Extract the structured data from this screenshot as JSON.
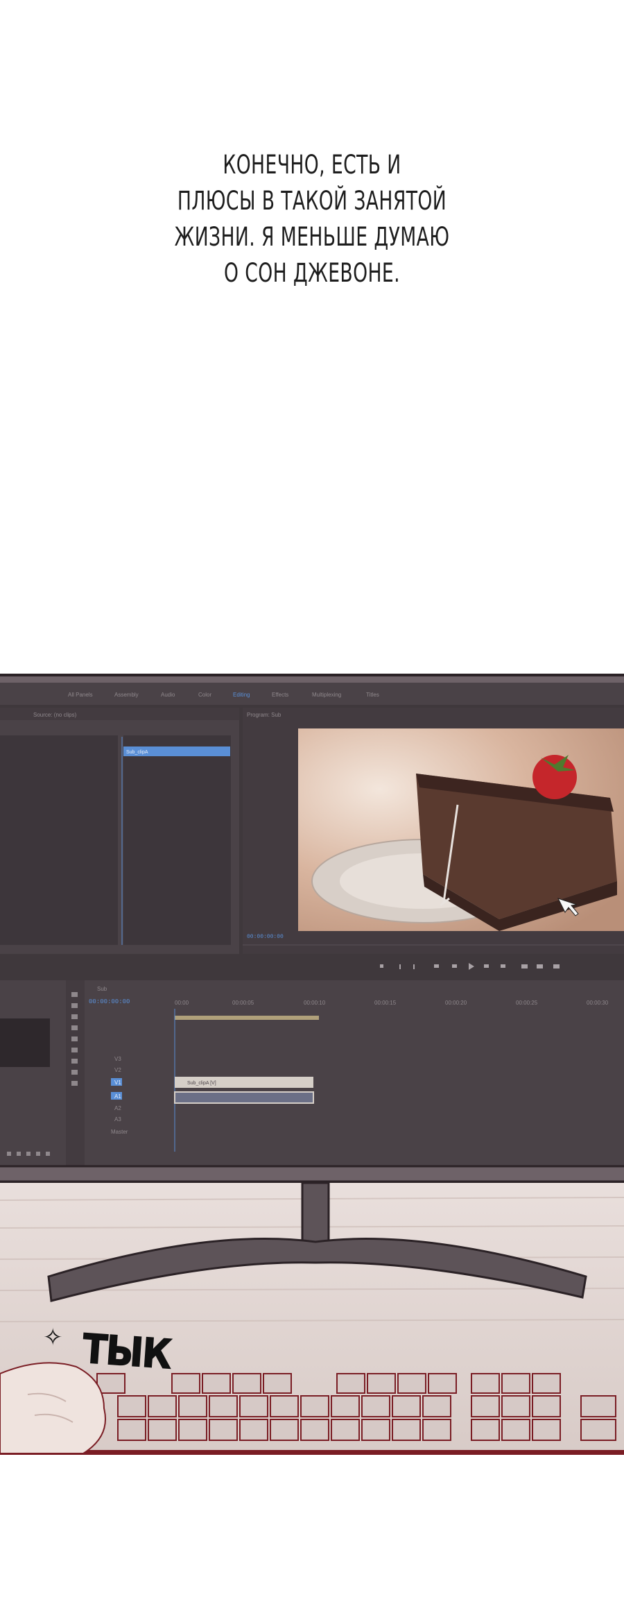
{
  "caption": {
    "lines": [
      "КОНЕЧНО, ЕСТЬ И",
      "ПЛЮСЫ В ТАКОЙ ЗАНЯТОЙ",
      "ЖИЗНИ. Я МЕНЬШЕ ДУМАЮ",
      "О СОН ДЖЕВОНЕ."
    ]
  },
  "editor": {
    "menu": [
      "All Panels",
      "Assembly",
      "Audio",
      "Color",
      "Editing",
      "Effects",
      "Multiplexing",
      "Titles"
    ],
    "active_menu": "Editing",
    "source_panel_tab": "Source: (no clips)",
    "program_panel_tab": "Program: Sub",
    "clip_label": "Sub_clipA",
    "timecode_program": "00:00:00:00",
    "timeline_tab": "Sub",
    "timeline_timecode": "00:00:00:00",
    "ruler_marks": [
      "00:00",
      "00:00:05",
      "00:00:10",
      "00:00:15",
      "00:00:20",
      "00:00:25",
      "00:00:30"
    ],
    "tracks": [
      "V3",
      "V2",
      "V1",
      "A1",
      "A2",
      "A3",
      "Master"
    ],
    "timeline_clip": "Sub_clipA [V]",
    "program_image": "chocolate-cake-with-strawberry",
    "colors": {
      "panel": "#4a4247",
      "panel_dark": "#3d363b",
      "accent": "#5a8fd6",
      "frame": "#6e6268"
    }
  },
  "sfx": {
    "text": "ТЫК"
  }
}
